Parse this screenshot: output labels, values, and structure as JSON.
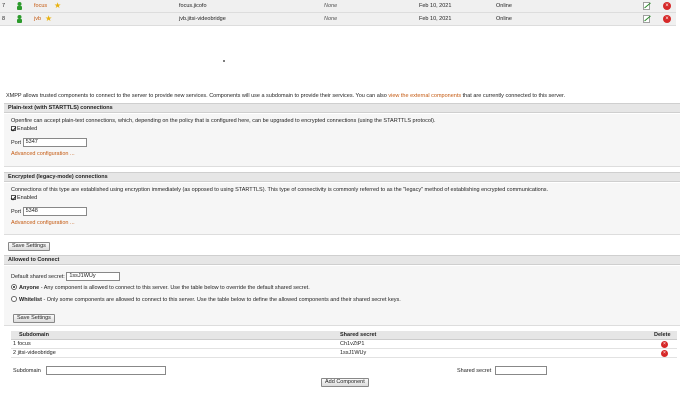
{
  "sessions": [
    {
      "index": "7",
      "name": "focus",
      "resource": "focus.jicofo",
      "presence": "None",
      "date": "Feb 10, 2021",
      "status": "Online"
    },
    {
      "index": "8",
      "name": "jvb",
      "resource": "jvb.jitsi-videobridge",
      "presence": "None",
      "date": "Feb 10, 2021",
      "status": "Online"
    }
  ],
  "intro": {
    "text": "XMPP allows trusted components to connect to the server to provide new services. Components will use a subdomain to provide their services. You can also ",
    "link": "view the external components",
    "suffix": " that are currently connected to this server."
  },
  "plain": {
    "title": "Plain-text (with STARTTLS) connections",
    "desc": "Openfire can accept plain-text connections, which, depending on the policy that is configured here, can be upgraded to encrypted connections (using the STARTTLS protocol).",
    "enabled_label": "Enabled",
    "port_label": "Port",
    "port_value": "5347",
    "advanced": "Advanced configuration ..."
  },
  "legacy": {
    "title": "Encrypted (legacy-mode) connections",
    "desc": "Connections of this type are established using encryption immediately (as opposed to using STARTTLS). This type of connectivity is commonly referred to as the \"legacy\" method of establishing encrypted communications.",
    "enabled_label": "Enabled",
    "port_label": "Port",
    "port_value": "5348",
    "advanced": "Advanced configuration ..."
  },
  "save_settings_label": "Save Settings",
  "allowed": {
    "title": "Allowed to Connect",
    "default_secret_label": "Default shared secret:",
    "default_secret_value": "1ssJ1WUy",
    "anyone_label": "Anyone",
    "anyone_desc": " - Any component is allowed to connect to this server. Use the table below to override the default shared secret.",
    "whitelist_label": "Whitelist",
    "whitelist_desc": " - Only some components are allowed to connect to this server. Use the table below to define the allowed components and their shared secret keys.",
    "save_label": "Save Settings"
  },
  "components": {
    "headers": {
      "subdomain": "Subdomain",
      "secret": "Shared secret",
      "delete": "Delete"
    },
    "rows": [
      {
        "label": "1 focus",
        "secret": "Ch1vZtP1"
      },
      {
        "label": "2 jitsi-videobridge",
        "secret": "1ssJ1WUy"
      }
    ],
    "subdomain_label": "Subdomain",
    "secret_label": "Shared secret",
    "add_label": "Add Component"
  },
  "colors": {
    "link": "#c55a11",
    "delete": "#d62828",
    "star": "#e8b10c"
  }
}
